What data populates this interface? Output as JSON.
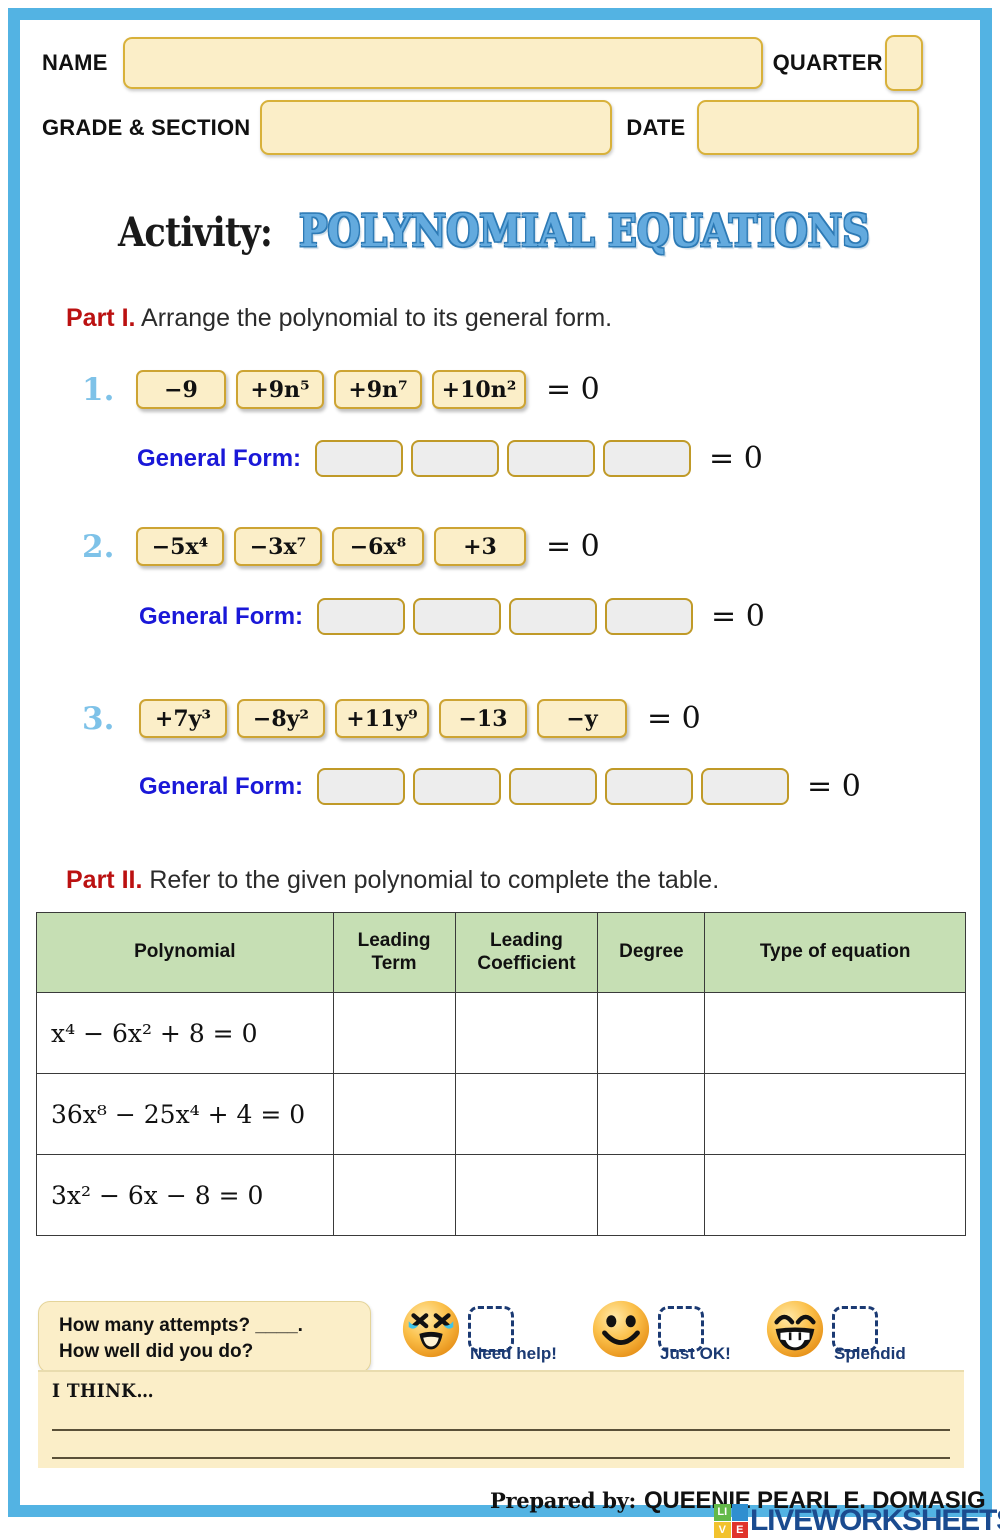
{
  "header": {
    "name_label": "NAME",
    "quarter_label": "QUARTER",
    "grade_label": "GRADE & SECTION",
    "date_label": "DATE",
    "name_value": "",
    "quarter_value": "",
    "grade_value": "",
    "date_value": ""
  },
  "title": {
    "prefix": "Activity:",
    "main": "POLYNOMIAL EQUATIONS"
  },
  "part1": {
    "label": "Part I.",
    "instruction": " Arrange the polynomial to its general form.",
    "general_form_label": "General Form:",
    "equals_zero": "= 0",
    "problems": [
      {
        "number": "1.",
        "terms": [
          "−9",
          "+9n⁵",
          "+9n⁷",
          "+10n²"
        ],
        "answer_slots": 4
      },
      {
        "number": "2.",
        "terms": [
          "−5x⁴",
          "−3x⁷",
          "−6x⁸",
          "+3"
        ],
        "answer_slots": 4
      },
      {
        "number": "3.",
        "terms": [
          "+7y³",
          "−8y²",
          "+11y⁹",
          "−13",
          "−y"
        ],
        "answer_slots": 5
      }
    ]
  },
  "part2": {
    "label": "Part II.",
    "instruction": " Refer to the given polynomial to complete the table.",
    "table": {
      "headers": [
        "Polynomial",
        "Leading Term",
        "Leading Coefficient",
        "Degree",
        "Type of equation"
      ],
      "header_lines": [
        [
          "Polynomial"
        ],
        [
          "Leading",
          "Term"
        ],
        [
          "Leading",
          "Coefficient"
        ],
        [
          "Degree"
        ],
        [
          "Type of equation"
        ]
      ],
      "rows": [
        {
          "polynomial": "x⁴ − 6x² + 8 = 0",
          "leading_term": "",
          "leading_coefficient": "",
          "degree": "",
          "type": ""
        },
        {
          "polynomial": "36x⁸ − 25x⁴ + 4 = 0",
          "leading_term": "",
          "leading_coefficient": "",
          "degree": "",
          "type": ""
        },
        {
          "polynomial": "3x² − 6x − 8 = 0",
          "leading_term": "",
          "leading_coefficient": "",
          "degree": "",
          "type": ""
        }
      ]
    }
  },
  "reflection": {
    "attempts_line1": "How many attempts? ____.",
    "attempts_line2": "How well did you do?",
    "moods": [
      {
        "label": "Need help!",
        "emoji": "crying-squinting-face"
      },
      {
        "label": "Just OK!",
        "emoji": "smiling-face"
      },
      {
        "label": "Splendid",
        "emoji": "grinning-face"
      }
    ],
    "think_label": "I THINK…"
  },
  "footer": {
    "prepared_by_label": "Prepared by:",
    "prepared_by_name": "QUEENIE PEARL E. DOMASIG",
    "logo_letters": [
      "LI",
      "I",
      "V",
      "E"
    ],
    "logo_cells": [
      "LI",
      "",
      "V",
      "E"
    ],
    "logo_word": "LIVEWORKSHEETS"
  },
  "colors": {
    "frame_blue": "#53b3e3",
    "tile_fill": "#fbeec8",
    "tile_border": "#cda433",
    "answer_fill": "#ededed",
    "answer_border": "#c09a28",
    "title_blue": "#63aade",
    "part_red": "#bb1111",
    "general_form_blue": "#1a18d8",
    "table_header_green": "#c6dfb4",
    "qnum_blue": "#7ec2e8",
    "mood_navy": "#1b3a73",
    "logo_blue": "#1b4b8f"
  }
}
